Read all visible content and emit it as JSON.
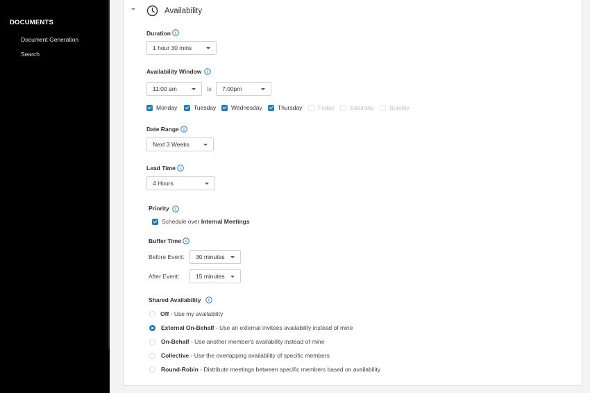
{
  "sidebar": {
    "title": "DOCUMENTS",
    "items": [
      {
        "label": "Document Generation"
      },
      {
        "label": "Search"
      }
    ]
  },
  "section": {
    "title": "Availability",
    "icon": "clock-icon"
  },
  "duration": {
    "label": "Duration",
    "value": "1 hour 30 mins"
  },
  "availability_window": {
    "label": "Availability Window",
    "start": "11:00 am",
    "to": "to",
    "end": "7:00pm"
  },
  "days": [
    {
      "label": "Monday",
      "checked": true
    },
    {
      "label": "Tuesday",
      "checked": true
    },
    {
      "label": "Wednesday",
      "checked": true
    },
    {
      "label": "Thursday",
      "checked": true
    },
    {
      "label": "Friday",
      "checked": false
    },
    {
      "label": "Saturday",
      "checked": false
    },
    {
      "label": "Sunday",
      "checked": false
    }
  ],
  "date_range": {
    "label": "Date Range",
    "value": "Next 3 Weeks"
  },
  "lead_time": {
    "label": "Lead Time",
    "value": "4 Hours"
  },
  "priority": {
    "label": "Priority",
    "checkbox_prefix": "Schedule over ",
    "checkbox_bold": "Internal Meetings",
    "checked": true
  },
  "buffer_time": {
    "label": "Buffer Time",
    "before_label": "Before Event:",
    "before_value": "30 minutes",
    "after_label": "After Event:",
    "after_value": "15 minutes"
  },
  "shared_availability": {
    "label": "Shared Availability",
    "selected_index": 1,
    "options": [
      {
        "name": "Off",
        "desc": " - Use my availability"
      },
      {
        "name": "External On-Behalf",
        "desc": " - Use an external invitees availability instead of mine"
      },
      {
        "name": "On-Behalf",
        "desc": " - Use another member's availability instead of mine"
      },
      {
        "name": "Collective",
        "desc": " - Use the overlapping availability of specific members"
      },
      {
        "name": "Round-Robin",
        "desc": " - Distribute meetings between specific members based on availability"
      }
    ]
  },
  "colors": {
    "accent": "#1d7ec7",
    "sidebar_bg": "#000000"
  }
}
